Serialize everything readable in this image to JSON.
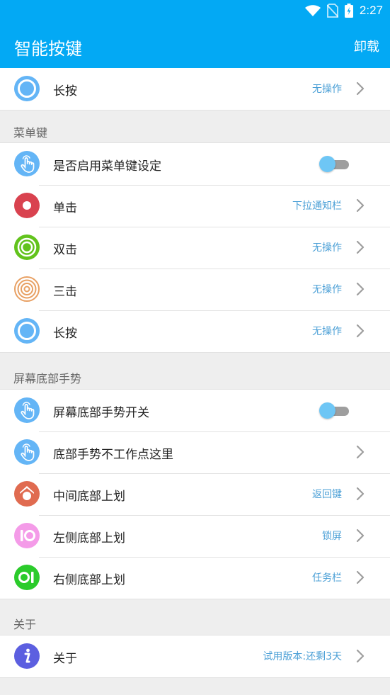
{
  "status_bar": {
    "time": "2:27"
  },
  "app_bar": {
    "title": "智能按键",
    "action_label": "卸载"
  },
  "sections": {
    "top": {
      "items": [
        {
          "label": "长按",
          "value": "无操作"
        }
      ]
    },
    "menu_key": {
      "header": "菜单键",
      "items": [
        {
          "label": "是否启用菜单键设定"
        },
        {
          "label": "单击",
          "value": "下拉通知栏"
        },
        {
          "label": "双击",
          "value": "无操作"
        },
        {
          "label": "三击",
          "value": "无操作"
        },
        {
          "label": "长按",
          "value": "无操作"
        }
      ]
    },
    "bottom_gesture": {
      "header": "屏幕底部手势",
      "items": [
        {
          "label": "屏幕底部手势开关"
        },
        {
          "label": "底部手势不工作点这里"
        },
        {
          "label": "中间底部上划",
          "value": "返回键"
        },
        {
          "label": "左侧底部上划",
          "value": "锁屏"
        },
        {
          "label": "右侧底部上划",
          "value": "任务栏"
        }
      ]
    },
    "about": {
      "header": "关于",
      "items": [
        {
          "label": "关于",
          "value": "试用版本:还剩3天"
        }
      ]
    }
  },
  "colors": {
    "primary": "#03a9f4",
    "link_value": "#4a9fd6",
    "icon_blue": "#64b5f6",
    "icon_red": "#d9424f",
    "icon_green": "#62c31c",
    "icon_orange": "#e8a063",
    "icon_coral": "#e06b50",
    "icon_pink": "#f49be8",
    "icon_bright_green": "#2bcb2b",
    "icon_purple": "#5c5fe0"
  },
  "icons": {
    "wifi": "wifi-icon",
    "no_sim": "no-sim-icon",
    "battery": "battery-charging-icon",
    "chevron": "chevron-right-icon"
  }
}
